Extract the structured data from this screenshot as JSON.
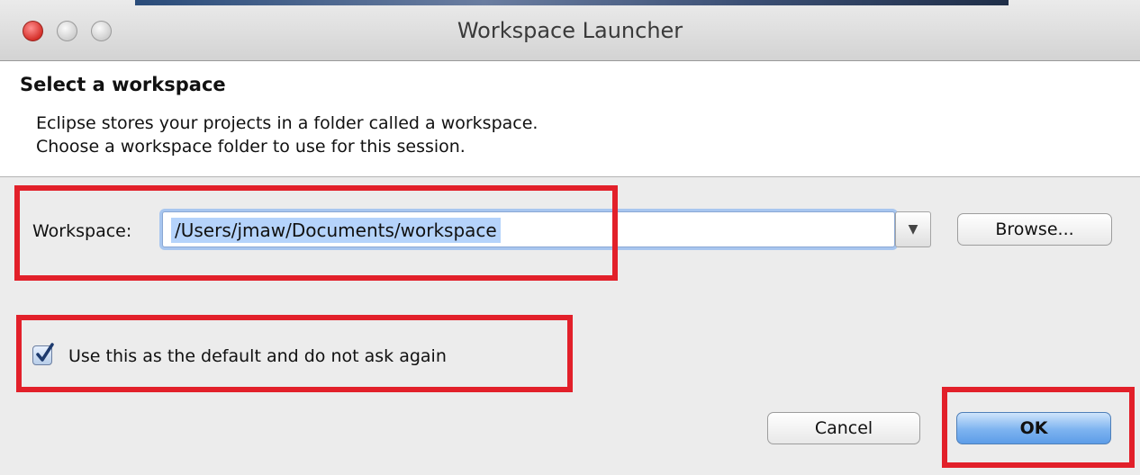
{
  "window": {
    "title": "Workspace Launcher"
  },
  "header": {
    "title": "Select a workspace",
    "description_line1": "Eclipse stores your projects in a folder called a workspace.",
    "description_line2": "Choose a workspace folder to use for this session."
  },
  "workspace": {
    "label": "Workspace:",
    "value": "/Users/jmaw/Documents/workspace",
    "dropdown_icon": "▼",
    "browse_label": "Browse..."
  },
  "default_option": {
    "label": "Use this as the default and do not ask again",
    "checked": true
  },
  "footer": {
    "cancel_label": "Cancel",
    "ok_label": "OK"
  },
  "colors": {
    "highlight": "#e2202a",
    "selection": "#b5d3fb",
    "focus_ring": "#a8c6ef",
    "ok_button": "#7db3f0"
  }
}
